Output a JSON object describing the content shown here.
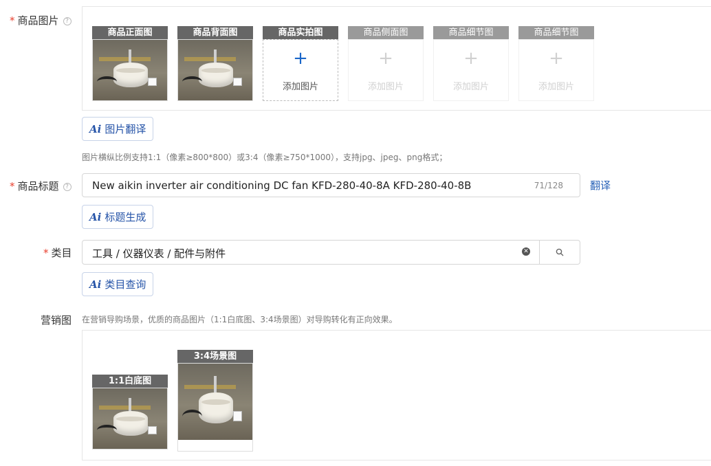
{
  "product_images": {
    "label": "商品图片",
    "slots": [
      {
        "caption": "商品正面图"
      },
      {
        "caption": "商品背面图"
      },
      {
        "caption": "商品实拍图",
        "add_text": "添加图片"
      },
      {
        "caption": "商品侧面图",
        "add_text": "添加图片"
      },
      {
        "caption": "商品细节图",
        "add_text": "添加图片"
      },
      {
        "caption": "商品细节图",
        "add_text": "添加图片"
      }
    ],
    "ai_button": "图片翻译",
    "hint": "图片横纵比例支持1:1（像素≥800*800）或3:4（像素≥750*1000），支持jpg、jpeg、png格式；"
  },
  "title_field": {
    "label": "商品标题",
    "value": "New  aikin inverter air conditioning DC fan KFD-280-40-8A KFD-280-40-8B",
    "count": "71/128",
    "translate_link": "翻译",
    "ai_button": "标题生成"
  },
  "category_field": {
    "label": "类目",
    "value": "工具 / 仪器仪表 / 配件与附件",
    "ai_button": "类目查询"
  },
  "marketing": {
    "label": "营销图",
    "hint": "在营销导购场景，优质的商品图片（1:1白底图、3:4场景图）对导购转化有正向效果。",
    "slots": [
      {
        "caption": "1:1白底图"
      },
      {
        "caption": "3:4场景图"
      }
    ]
  },
  "ai_icon_text": "Ai",
  "required_mark": "*",
  "icons": {
    "help": "help-circle-icon",
    "plus": "plus-icon",
    "clear": "clear-circle-icon",
    "search": "search-icon"
  },
  "colors": {
    "accent": "#2654a8",
    "required": "#e8402f",
    "caption_bg": "#666666"
  }
}
